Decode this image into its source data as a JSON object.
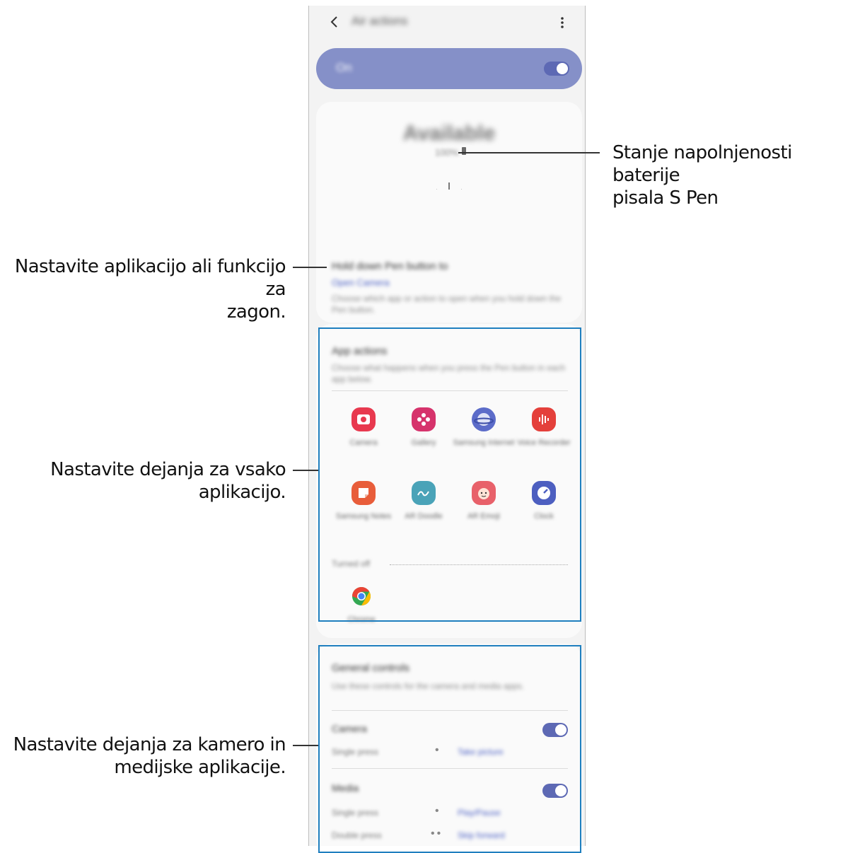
{
  "app": {
    "title": "Air actions",
    "master_label": "On"
  },
  "status": {
    "text": "Available",
    "battery_text": "100%"
  },
  "button_section": {
    "title": "Hold down Pen button to",
    "link": "Open Camera",
    "description": "Choose which app or action to open when you hold down the Pen button."
  },
  "app_actions": {
    "title": "App actions",
    "description": "Choose what happens when you press the Pen button in each app below.",
    "apps": [
      {
        "label": "Camera",
        "icon": "camera-icon",
        "color": "#e8394f"
      },
      {
        "label": "Gallery",
        "icon": "gallery-icon",
        "color": "#d6336c"
      },
      {
        "label": "Samsung Internet",
        "icon": "internet-icon",
        "color": "#5c6cc9"
      },
      {
        "label": "Voice Recorder",
        "icon": "voice-recorder-icon",
        "color": "#e4403b"
      },
      {
        "label": "Samsung Notes",
        "icon": "notes-icon",
        "color": "#e85d3a"
      },
      {
        "label": "AR Doodle",
        "icon": "ar-doodle-icon",
        "color": "#4aa3b8"
      },
      {
        "label": "AR Emoji",
        "icon": "ar-emoji-icon",
        "color": "#e8616a"
      },
      {
        "label": "Clock",
        "icon": "clock-icon",
        "color": "#4d5fc0"
      }
    ],
    "other_label": "Turned off",
    "other_apps": [
      {
        "label": "Chrome",
        "icon": "chrome-icon"
      }
    ]
  },
  "general": {
    "title": "General controls",
    "description": "Use these controls for the camera and media apps.",
    "groups": [
      {
        "name": "Camera",
        "rows": [
          {
            "gesture": "Single press",
            "dots": "•",
            "action": "Take picture"
          }
        ]
      },
      {
        "name": "Media",
        "rows": [
          {
            "gesture": "Single press",
            "dots": "•",
            "action": "Play/Pause"
          },
          {
            "gesture": "Double press",
            "dots": "••",
            "action": "Skip forward"
          }
        ]
      }
    ]
  },
  "callouts": {
    "battery": [
      "Stanje napolnjenosti baterije",
      "pisala S Pen"
    ],
    "button": [
      "Nastavite aplikacijo ali funkcijo za",
      "zagon."
    ],
    "apps": [
      "Nastavite dejanja za vsako",
      "aplikacijo."
    ],
    "media": [
      "Nastavite dejanja za kamero in",
      "medijske aplikacije."
    ]
  },
  "colors": {
    "accent": "#5c66b0",
    "highlight": "#1f7fbf",
    "master_bar": "#8590c8"
  }
}
